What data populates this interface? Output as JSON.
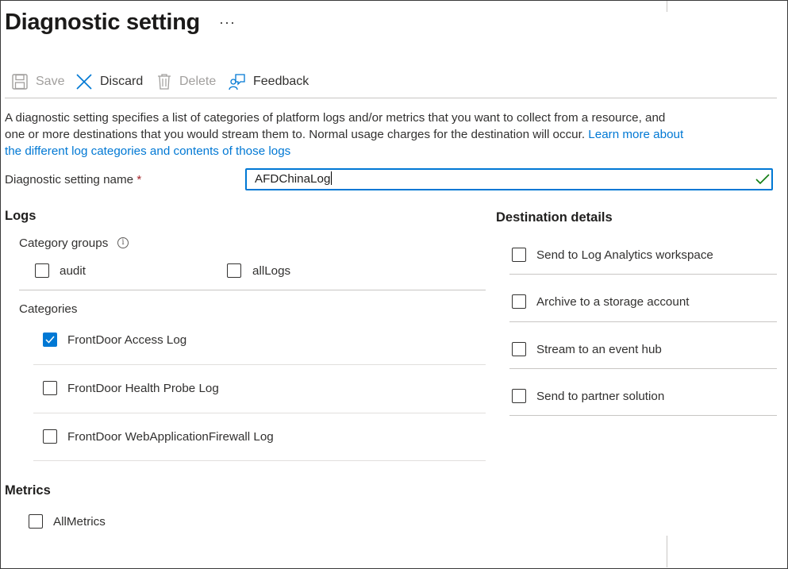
{
  "page": {
    "title": "Diagnostic setting",
    "more_label": "···"
  },
  "toolbar": {
    "save_label": "Save",
    "discard_label": "Discard",
    "delete_label": "Delete",
    "feedback_label": "Feedback"
  },
  "description": {
    "text": "A diagnostic setting specifies a list of categories of platform logs and/or metrics that you want to collect from a resource, and one or more destinations that you would stream them to. Normal usage charges for the destination will occur.",
    "link_text": "Learn more about the different log categories and contents of those logs"
  },
  "setting_name": {
    "label": "Diagnostic setting name",
    "required_mark": "*",
    "value": "AFDChinaLog"
  },
  "logs": {
    "title": "Logs",
    "category_groups_label": "Category groups",
    "info_glyph": "i",
    "category_groups": [
      {
        "label": "audit",
        "checked": false
      },
      {
        "label": "allLogs",
        "checked": false
      }
    ],
    "categories_label": "Categories",
    "categories": [
      {
        "label": "FrontDoor Access Log",
        "checked": true
      },
      {
        "label": "FrontDoor Health Probe Log",
        "checked": false
      },
      {
        "label": "FrontDoor WebApplicationFirewall Log",
        "checked": false
      }
    ]
  },
  "metrics": {
    "title": "Metrics",
    "items": [
      {
        "label": "AllMetrics",
        "checked": false
      }
    ]
  },
  "destination": {
    "title": "Destination details",
    "items": [
      {
        "label": "Send to Log Analytics workspace",
        "checked": false
      },
      {
        "label": "Archive to a storage account",
        "checked": false
      },
      {
        "label": "Stream to an event hub",
        "checked": false
      },
      {
        "label": "Send to partner solution",
        "checked": false
      }
    ]
  },
  "colors": {
    "accent": "#0078d4",
    "valid": "#107c10",
    "required": "#a4262c"
  }
}
